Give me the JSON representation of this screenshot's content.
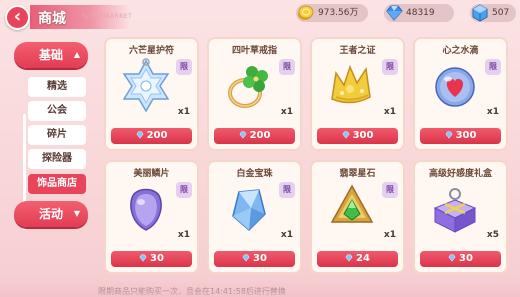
{
  "header": {
    "title": "商城",
    "subtitle": "SUPERMARKET",
    "back_icon": "back-arrow-icon",
    "currencies": [
      {
        "icon": "gold-coin-icon",
        "value": "973.56万",
        "color": "#f2c230"
      },
      {
        "icon": "blue-gem-icon",
        "value": "48319",
        "color": "#3b8ee8"
      },
      {
        "icon": "crystal-cube-icon",
        "value": "507",
        "color": "#4aa3e8"
      }
    ]
  },
  "sidebar": {
    "basic_label": "基础",
    "activity_label": "活动",
    "items": [
      {
        "label": "精选"
      },
      {
        "label": "公会"
      },
      {
        "label": "碎片"
      },
      {
        "label": "探险器"
      },
      {
        "label": "饰品商店",
        "active": true
      }
    ]
  },
  "items": [
    {
      "name": "六芒星护符",
      "icon": "hexagram-charm-icon",
      "qty": "x1",
      "price": "200",
      "limited": true
    },
    {
      "name": "四叶草戒指",
      "icon": "clover-ring-icon",
      "qty": "x1",
      "price": "200",
      "limited": true
    },
    {
      "name": "王者之证",
      "icon": "kings-proof-icon",
      "qty": "x1",
      "price": "300",
      "limited": true
    },
    {
      "name": "心之水滴",
      "icon": "heart-droplet-icon",
      "qty": "x1",
      "price": "300",
      "limited": true
    },
    {
      "name": "美丽鳞片",
      "icon": "scale-icon",
      "qty": "x1",
      "price": "30",
      "limited": true
    },
    {
      "name": "白金宝珠",
      "icon": "platinum-gem-icon",
      "qty": "x1",
      "price": "30",
      "limited": true
    },
    {
      "name": "翡翠星石",
      "icon": "emerald-star-icon",
      "qty": "x1",
      "price": "24",
      "limited": true
    },
    {
      "name": "高级好感度礼盒",
      "icon": "gift-box-icon",
      "qty": "x5",
      "price": "30",
      "limited": false
    }
  ],
  "limit_label": "限",
  "price_currency_icon": "blue-gem-icon",
  "footer_note": "限期商品只能购买一次，且会在14:41:58后进行替换",
  "colors": {
    "accent": "#e8455a",
    "card_bg": "#fff7f1",
    "card_border": "#f4d7c8"
  }
}
